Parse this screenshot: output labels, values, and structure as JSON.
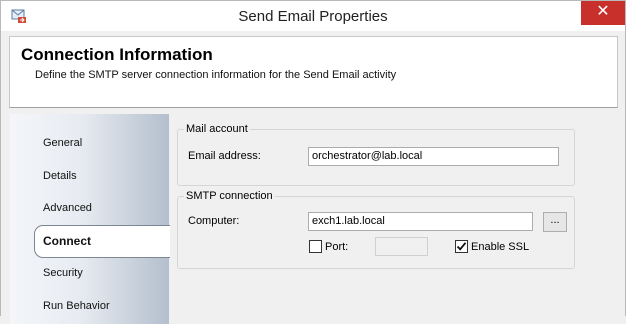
{
  "window": {
    "title": "Send Email Properties",
    "close_glyph": "✕",
    "app_icon": "send-email-icon"
  },
  "header": {
    "title": "Connection Information",
    "subtitle": "Define the SMTP server connection information for the Send Email activity"
  },
  "nav": {
    "items": [
      {
        "label": "General"
      },
      {
        "label": "Details"
      },
      {
        "label": "Advanced"
      },
      {
        "label": "Connect",
        "selected": true
      },
      {
        "label": "Security"
      },
      {
        "label": "Run Behavior"
      }
    ]
  },
  "mail_account": {
    "group_title": "Mail account",
    "email_label": "Email address:",
    "email_value": "orchestrator@lab.local"
  },
  "smtp": {
    "group_title": "SMTP connection",
    "computer_label": "Computer:",
    "computer_value": "exch1.lab.local",
    "browse_label": "...",
    "port_label": "Port:",
    "port_checked": false,
    "port_value": "",
    "ssl_label": "Enable SSL",
    "ssl_checked": true
  }
}
